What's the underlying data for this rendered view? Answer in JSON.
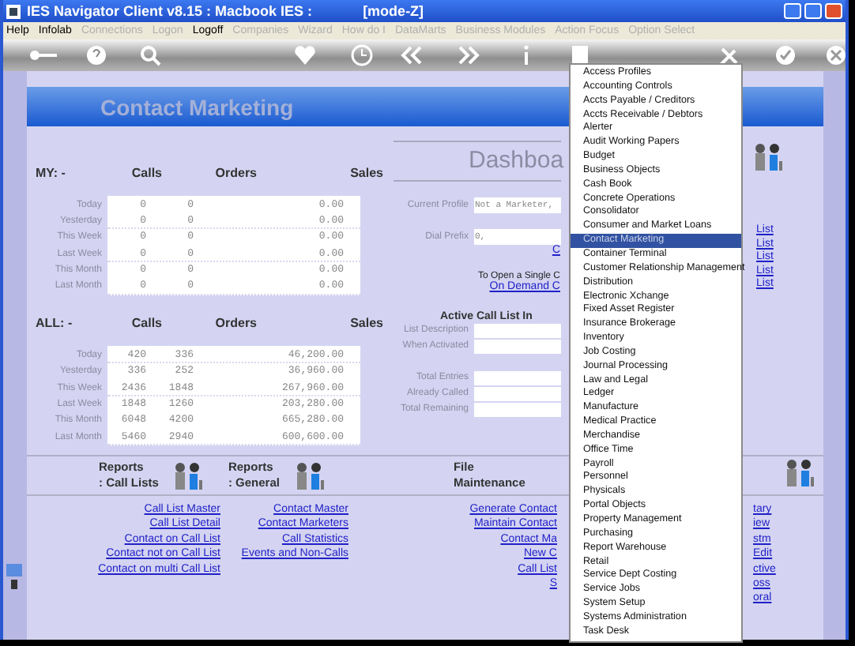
{
  "window": {
    "title": "IES Navigator Client v8.15 : Macbook IES :",
    "mode": "[mode-Z]"
  },
  "menu": [
    {
      "label": "Help",
      "disabled": false
    },
    {
      "label": "Infolab",
      "disabled": false
    },
    {
      "label": "Connections",
      "disabled": true
    },
    {
      "label": "Logon",
      "disabled": true
    },
    {
      "label": "Logoff",
      "disabled": false
    },
    {
      "label": "Companies",
      "disabled": true
    },
    {
      "label": "Wizard",
      "disabled": true
    },
    {
      "label": "How do I",
      "disabled": true
    },
    {
      "label": "DataMarts",
      "disabled": true
    },
    {
      "label": "Business Modules",
      "disabled": true
    },
    {
      "label": "Action Focus",
      "disabled": true
    },
    {
      "label": "Option Select",
      "disabled": true
    }
  ],
  "page_title": "Contact Marketing",
  "stats": [
    {
      "label": "MY: -",
      "columns": [
        "Calls",
        "Orders",
        "Sales"
      ],
      "rows": [
        {
          "period": "Today",
          "calls": "0",
          "orders": "0",
          "sales": "0.00"
        },
        {
          "period": "Yesterday",
          "calls": "0",
          "orders": "0",
          "sales": "0.00"
        },
        {
          "period": "This Week",
          "calls": "0",
          "orders": "0",
          "sales": "0.00"
        },
        {
          "period": "Last Week",
          "calls": "0",
          "orders": "0",
          "sales": "0.00"
        },
        {
          "period": "This Month",
          "calls": "0",
          "orders": "0",
          "sales": "0.00"
        },
        {
          "period": "Last Month",
          "calls": "0",
          "orders": "0",
          "sales": "0.00"
        }
      ]
    },
    {
      "label": "ALL: -",
      "columns": [
        "Calls",
        "Orders",
        "Sales"
      ],
      "rows": [
        {
          "period": "Today",
          "calls": "420",
          "orders": "336",
          "sales": "46,200.00"
        },
        {
          "period": "Yesterday",
          "calls": "336",
          "orders": "252",
          "sales": "36,960.00"
        },
        {
          "period": "This Week",
          "calls": "2436",
          "orders": "1848",
          "sales": "267,960.00"
        },
        {
          "period": "Last Week",
          "calls": "1848",
          "orders": "1260",
          "sales": "203,280.00"
        },
        {
          "period": "This Month",
          "calls": "6048",
          "orders": "4200",
          "sales": "665,280.00"
        },
        {
          "period": "Last Month",
          "calls": "5460",
          "orders": "2940",
          "sales": "600,600.00"
        }
      ]
    }
  ],
  "dashboard": {
    "title": "Dashboa",
    "profile_fields": [
      {
        "label": "Current Profile",
        "value": "Not a Marketer,"
      },
      {
        "label": "Dial Prefix",
        "value": "0,"
      }
    ],
    "link": "C",
    "open_hint": "To Open a Single C",
    "on_demand_link": "On Demand C",
    "active_title": "Active Call List In",
    "active_fields": [
      {
        "label": "List Description"
      },
      {
        "label": "When Activated"
      }
    ],
    "count_fields": [
      {
        "label": "Total Entries"
      },
      {
        "label": "Already Called"
      },
      {
        "label": "Total Remaining"
      }
    ]
  },
  "right_links": [
    "List",
    "List",
    "List",
    "List",
    "List"
  ],
  "reports": [
    {
      "title": "Reports",
      "subtitle": ": Call Lists",
      "icon": true,
      "links": [
        "Call List Master",
        "Call List Detail",
        "Contact on Call List",
        "Contact not on Call List",
        "Contact on multi Call List"
      ]
    },
    {
      "title": "Reports",
      "subtitle": ": General",
      "icon": true,
      "links": [
        "Contact Master",
        "Contact Marketers",
        "Call Statistics",
        "Events and Non-Calls"
      ]
    },
    {
      "title": "File",
      "subtitle": "Maintenance",
      "icon": false,
      "links": [
        "Generate Contact",
        "Maintain Contact",
        "Contact Ma",
        "New C",
        "Call List",
        "S"
      ]
    }
  ],
  "right_fragments": [
    "tary",
    "iew",
    "stm",
    "Edit",
    "ctive",
    "oss",
    "oral"
  ],
  "module_menu": [
    {
      "label": "Access Profiles",
      "selected": false
    },
    {
      "label": "Accounting Controls",
      "selected": false
    },
    {
      "label": "Accts Payable / Creditors",
      "selected": false
    },
    {
      "label": "Accts Receivable / Debtors",
      "selected": false
    },
    {
      "label": "Alerter",
      "selected": false
    },
    {
      "label": "Audit Working Papers",
      "selected": false
    },
    {
      "label": "Budget",
      "selected": false
    },
    {
      "label": "Business Objects",
      "selected": false
    },
    {
      "label": "Cash Book",
      "selected": false
    },
    {
      "label": "Concrete Operations",
      "selected": false
    },
    {
      "label": "Consolidator",
      "selected": false
    },
    {
      "label": "Consumer and Market Loans",
      "selected": false
    },
    {
      "label": "Contact Marketing",
      "selected": true
    },
    {
      "label": "Container Terminal",
      "selected": false
    },
    {
      "label": "Customer Relationship Management",
      "selected": false
    },
    {
      "label": "Distribution",
      "selected": false
    },
    {
      "label": "Electronic Xchange",
      "selected": false
    },
    {
      "label": "Fixed Asset Register",
      "selected": false
    },
    {
      "label": "Insurance Brokerage",
      "selected": false
    },
    {
      "label": "Inventory",
      "selected": false
    },
    {
      "label": "Job Costing",
      "selected": false
    },
    {
      "label": "Journal Processing",
      "selected": false
    },
    {
      "label": "Law and Legal",
      "selected": false
    },
    {
      "label": "Ledger",
      "selected": false
    },
    {
      "label": "Manufacture",
      "selected": false
    },
    {
      "label": "Medical Practice",
      "selected": false
    },
    {
      "label": "Merchandise",
      "selected": false
    },
    {
      "label": "Office Time",
      "selected": false
    },
    {
      "label": "Payroll",
      "selected": false
    },
    {
      "label": "Personnel",
      "selected": false
    },
    {
      "label": "Physicals",
      "selected": false
    },
    {
      "label": "Portal Objects",
      "selected": false
    },
    {
      "label": "Property Management",
      "selected": false
    },
    {
      "label": "Purchasing",
      "selected": false
    },
    {
      "label": "Report Warehouse",
      "selected": false
    },
    {
      "label": "Retail",
      "selected": false
    },
    {
      "label": "Service Dept Costing",
      "selected": false
    },
    {
      "label": "Service Jobs",
      "selected": false
    },
    {
      "label": "System Setup",
      "selected": false
    },
    {
      "label": "Systems Administration",
      "selected": false
    },
    {
      "label": "Task Desk",
      "selected": false
    }
  ]
}
